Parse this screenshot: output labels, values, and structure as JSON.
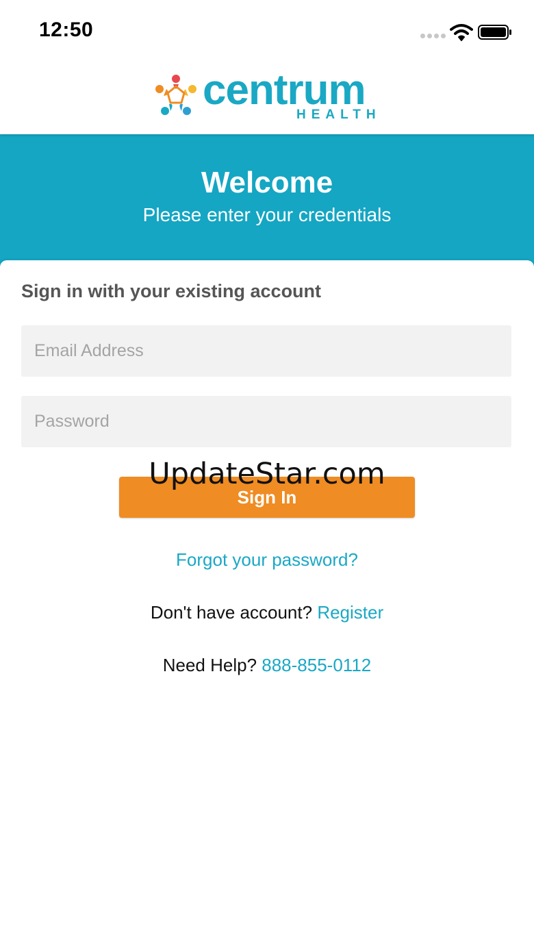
{
  "status_bar": {
    "time": "12:50",
    "icons": [
      "signal-dots-icon",
      "wifi-icon",
      "battery-icon"
    ]
  },
  "logo": {
    "wordmark": "centrum",
    "submark": "HEALTH",
    "colors": {
      "teal": "#1aa8c4",
      "orange": "#ef8c23",
      "red": "#e8474e",
      "yellow": "#f5b82e",
      "blue": "#2e9fd1"
    }
  },
  "banner": {
    "title": "Welcome",
    "subtitle": "Please enter your credentials",
    "color": "#14a6c3"
  },
  "form": {
    "heading": "Sign in with your existing account",
    "email": {
      "value": "",
      "placeholder": "Email Address"
    },
    "password": {
      "value": "",
      "placeholder": "Password"
    },
    "submit_label": "Sign In",
    "submit_color": "#ef8c23"
  },
  "links": {
    "forgot_password": "Forgot your password?",
    "register_prompt": "Don't have account?",
    "register_label": "Register",
    "help_prompt": "Need Help?",
    "help_phone": "888-855-0112"
  },
  "watermark": "UpdateStar.com"
}
